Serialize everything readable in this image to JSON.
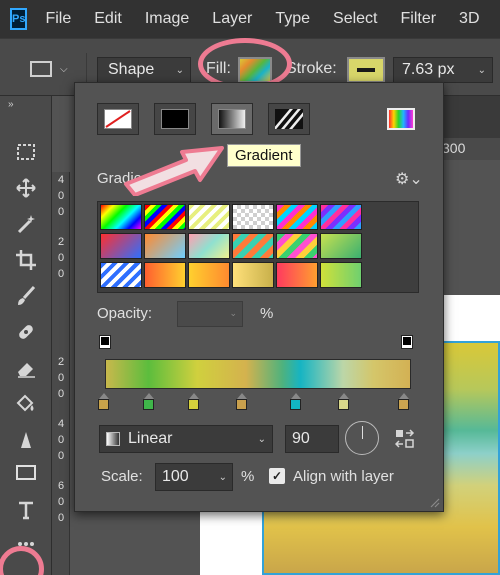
{
  "app": {
    "logo": "Ps"
  },
  "menu": [
    "File",
    "Edit",
    "Image",
    "Layer",
    "Type",
    "Select",
    "Filter",
    "3D"
  ],
  "options_bar": {
    "tool_mode": "Shape",
    "fill_label": "Fill:",
    "stroke_label": "Stroke:",
    "stroke_width": "7.63 px"
  },
  "rulers": {
    "horizontal": "300",
    "vertical_digits": [
      "4",
      "0",
      "0",
      "2",
      "0",
      "0",
      "2",
      "0",
      "0",
      "4",
      "0",
      "0",
      "6",
      "0",
      "0"
    ]
  },
  "fill_popup": {
    "fill_types": [
      "no-color",
      "solid-color",
      "gradient",
      "pattern"
    ],
    "selected_fill_type": "gradient",
    "tooltip": "Gradient",
    "gradients_label": "Gradients",
    "opacity_label": "Opacity:",
    "opacity_value": "",
    "opacity_unit": "%",
    "style": "Linear",
    "angle": "90",
    "scale_label": "Scale:",
    "scale": "100",
    "scale_unit": "%",
    "align_with_layer_label": "Align with layer",
    "align_with_layer_checked": true,
    "color_stop_colors": [
      "#c7a24a",
      "#3fb64a",
      "#d6d13c",
      "#c9a04d",
      "#12b5c4",
      "#d9d88a",
      "#cba450"
    ],
    "opacity_stops": 2
  },
  "colors": {
    "highlight_circle": "#ee7b92",
    "tooltip_bg": "#ffffcc",
    "ps_blue": "#31a8ff",
    "selection_blue": "#33a2d8"
  },
  "icons": {
    "settings": "gear-icon",
    "reverse": "reverse-gradient-icon",
    "angle": "angle-dial-icon"
  }
}
